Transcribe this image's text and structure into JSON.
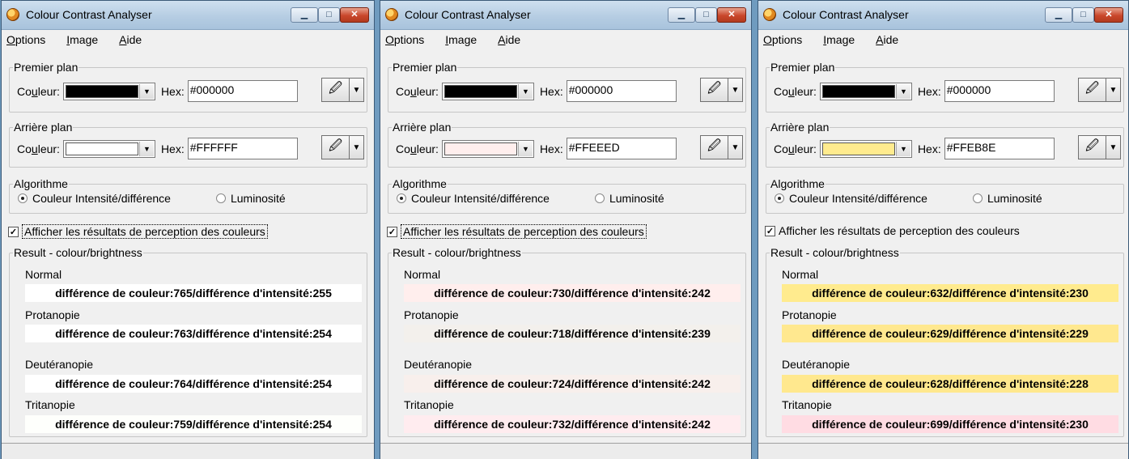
{
  "windows": [
    {
      "title": "Colour Contrast Analyser",
      "menu": [
        "Options",
        "Image",
        "Aide"
      ],
      "foreground": {
        "group_label": "Premier plan",
        "color_label": "Couleur:",
        "hex_label": "Hex:",
        "hex_value": "#000000",
        "swatch": "#000000"
      },
      "background": {
        "group_label": "Arrière plan",
        "color_label": "Couleur:",
        "hex_label": "Hex:",
        "hex_value": "#FFFFFF",
        "swatch": "#FFFFFF"
      },
      "algorithm": {
        "group_label": "Algorithme",
        "option1": "Couleur Intensité/différence",
        "option2": "Luminosité",
        "selected": 1
      },
      "show_results_label": "Afficher les résultats de perception des couleurs",
      "show_results_checked": true,
      "show_results_focused": true,
      "results": {
        "group_label": "Result - colour/brightness",
        "rows": [
          {
            "label": "Normal",
            "text": "différence de couleur:765/différence d'intensité:255",
            "bg": "#FFFFFF"
          },
          {
            "label": "Protanopie",
            "text": "différence de couleur:763/différence d'intensité:254",
            "bg": "#FFFFFF"
          },
          {
            "label": "Deutéranopie",
            "text": "différence de couleur:764/différence d'intensité:254",
            "bg": "#FFFFFF"
          },
          {
            "label": "Tritanopie",
            "text": "différence de couleur:759/différence d'intensité:254",
            "bg": "#FEFFFC"
          }
        ]
      }
    },
    {
      "title": "Colour Contrast Analyser",
      "menu": [
        "Options",
        "Image",
        "Aide"
      ],
      "foreground": {
        "group_label": "Premier plan",
        "color_label": "Couleur:",
        "hex_label": "Hex:",
        "hex_value": "#000000",
        "swatch": "#000000"
      },
      "background": {
        "group_label": "Arrière plan",
        "color_label": "Couleur:",
        "hex_label": "Hex:",
        "hex_value": "#FFEEED",
        "swatch": "#FFEEED"
      },
      "algorithm": {
        "group_label": "Algorithme",
        "option1": "Couleur Intensité/différence",
        "option2": "Luminosité",
        "selected": 1
      },
      "show_results_label": "Afficher les résultats de perception des couleurs",
      "show_results_checked": true,
      "show_results_focused": true,
      "results": {
        "group_label": "Result - colour/brightness",
        "rows": [
          {
            "label": "Normal",
            "text": "différence de couleur:730/différence d'intensité:242",
            "bg": "#FFEEED"
          },
          {
            "label": "Protanopie",
            "text": "différence de couleur:718/différence d'intensité:239",
            "bg": "#F3F0EC"
          },
          {
            "label": "Deutéranopie",
            "text": "différence de couleur:724/différence d'intensité:242",
            "bg": "#F8EFEC"
          },
          {
            "label": "Tritanopie",
            "text": "différence de couleur:732/différence d'intensité:242",
            "bg": "#FFECEF"
          }
        ]
      }
    },
    {
      "title": "Colour Contrast Analyser",
      "menu": [
        "Options",
        "Image",
        "Aide"
      ],
      "foreground": {
        "group_label": "Premier plan",
        "color_label": "Couleur:",
        "hex_label": "Hex:",
        "hex_value": "#000000",
        "swatch": "#000000"
      },
      "background": {
        "group_label": "Arrière plan",
        "color_label": "Couleur:",
        "hex_label": "Hex:",
        "hex_value": "#FFEB8E",
        "swatch": "#FFEB8E"
      },
      "algorithm": {
        "group_label": "Algorithme",
        "option1": "Couleur Intensité/différence",
        "option2": "Luminosité",
        "selected": 1
      },
      "show_results_label": "Afficher les résultats de perception des couleurs",
      "show_results_checked": true,
      "show_results_focused": false,
      "results": {
        "group_label": "Result - colour/brightness",
        "rows": [
          {
            "label": "Normal",
            "text": "différence de couleur:632/différence d'intensité:230",
            "bg": "#FFEB8E"
          },
          {
            "label": "Protanopie",
            "text": "différence de couleur:629/différence d'intensité:229",
            "bg": "#FFE88F"
          },
          {
            "label": "Deutéranopie",
            "text": "différence de couleur:628/différence d'intensité:228",
            "bg": "#FFE88E"
          },
          {
            "label": "Tritanopie",
            "text": "différence de couleur:699/différence d'intensité:230",
            "bg": "#FFDCE3"
          }
        ]
      }
    }
  ]
}
